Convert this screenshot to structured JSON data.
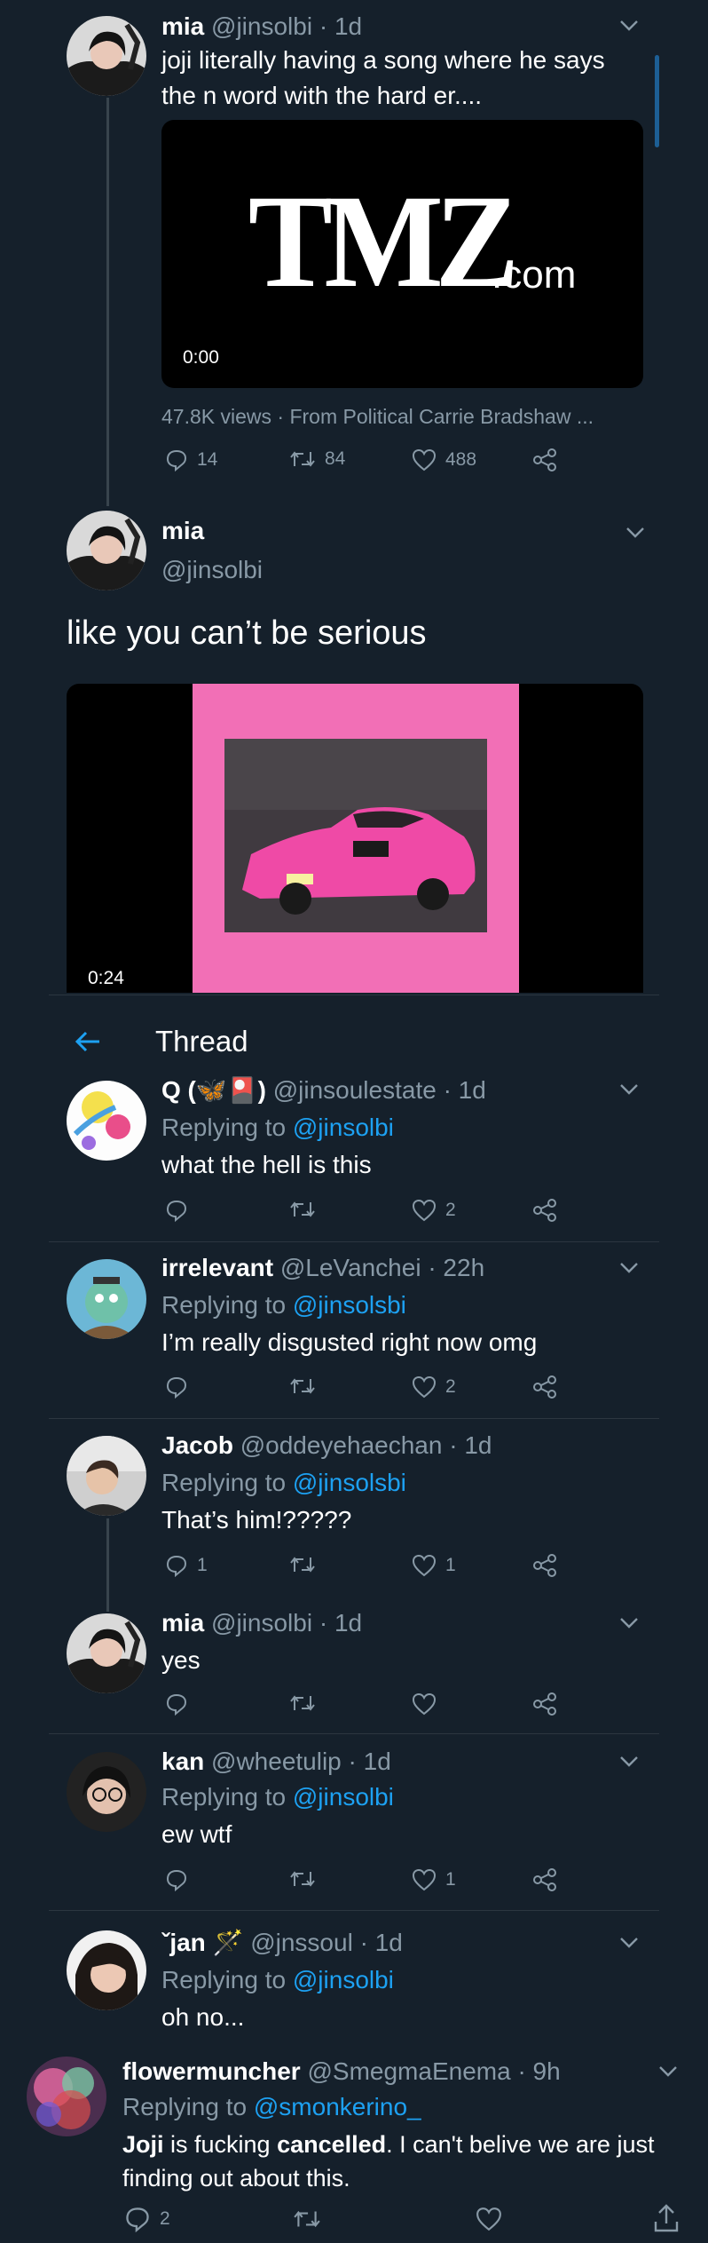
{
  "tweet1": {
    "name": "mia",
    "handle": "@jinsolbi",
    "time": "· 1d",
    "text": "joji literally having a song where he says the n word with the hard er....",
    "video_brand": "TMZ",
    "video_brand_suffix": ".com",
    "video_time": "0:00",
    "views_line": "47.8K views · From Political Carrie Bradshaw ...",
    "replies": "14",
    "retweets": "84",
    "likes": "488"
  },
  "tweet2": {
    "name": "mia",
    "handle": "@jinsolbi",
    "text": "like you can’t be serious",
    "video_time": "0:24"
  },
  "thread_header": {
    "title": "Thread"
  },
  "replies": [
    {
      "name": "Q (🦋🎴)",
      "handle": "@jinsoulestate",
      "time": "· 1d",
      "replying_label": "Replying to",
      "replying_to": "@jinsolbi",
      "text": "what the hell is this",
      "replies": "",
      "likes": "2"
    },
    {
      "name": "irrelevant",
      "handle": "@LeVanchei",
      "time": "· 22h",
      "replying_label": "Replying to",
      "replying_to": "@jinsolsbi",
      "text": "I’m really disgusted right now omg",
      "replies": "",
      "likes": "2"
    },
    {
      "name": "Jacob",
      "handle": "@oddeyehaechan",
      "time": "· 1d",
      "replying_label": "Replying to",
      "replying_to": "@jinsolsbi",
      "text": "That’s him!?????",
      "replies": "1",
      "likes": "1"
    },
    {
      "name": "mia",
      "handle": "@jinsolbi",
      "time": "· 1d",
      "text": "yes",
      "replies": "",
      "likes": ""
    },
    {
      "name": "kan",
      "handle": "@wheetulip",
      "time": "· 1d",
      "replying_label": "Replying to",
      "replying_to": "@jinsolbi",
      "text": "ew wtf",
      "replies": "",
      "likes": "1"
    },
    {
      "name": "ˇjan 🪄",
      "handle": "@jnssoul",
      "time": "· 1d",
      "replying_label": "Replying to",
      "replying_to": "@jinsolbi",
      "text": "oh no...",
      "replies": "",
      "likes": ""
    }
  ],
  "outer": {
    "name": "flowermuncher",
    "handle": "@SmegmaEnema",
    "time": "· 9h",
    "replying_label": "Replying to",
    "replying_to": "@smonkerino_",
    "text_part1": "Joji",
    "text_part2": " is fucking ",
    "text_part3": "cancelled",
    "text_part4": ". I can't belive we are just finding out about this.",
    "replies": "2"
  },
  "colors": {
    "background": "#15202b",
    "accent": "#1da1f2",
    "muted": "#8899a6",
    "pink": "#f26fb6"
  }
}
